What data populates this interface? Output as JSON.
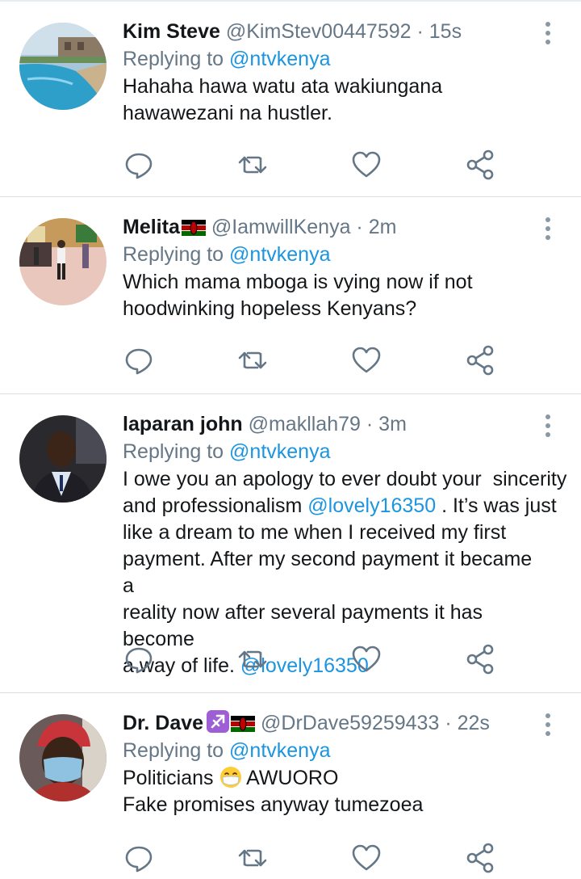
{
  "colors": {
    "accent": "#1b95e0",
    "muted": "#657786",
    "text": "#14171a",
    "divider": "#e6ecf0"
  },
  "icons": {
    "more": "more-vertical-icon",
    "reply": "reply-icon",
    "retweet": "retweet-icon",
    "like": "heart-icon",
    "share": "share-icon"
  },
  "tweets": [
    {
      "name": "Kim Steve",
      "handle": "@KimStev00447592",
      "separator": "·",
      "time": "15s",
      "replying_prefix": "Replying to",
      "replying_to": "@ntvkenya",
      "text_lines": [
        "Hahaha hawa watu ata wakiungana",
        "hawawezani na hustler."
      ]
    },
    {
      "name": "Melita",
      "handle": "@IamwillKenya",
      "separator": "·",
      "time": "2m",
      "replying_prefix": "Replying to",
      "replying_to": "@ntvkenya",
      "text_lines": [
        "Which mama mboga is vying now if not",
        "hoodwinking hopeless Kenyans?"
      ]
    },
    {
      "name": "laparan john",
      "handle": "@makllah79",
      "separator": "·",
      "time": "3m",
      "replying_prefix": "Replying to",
      "replying_to": "@ntvkenya",
      "text_line1": "I owe you an apology to ever doubt your  sincerity",
      "text_line2_pre": "and professionalism ",
      "mention_1": "@lovely16350",
      "text_line2_post": " . It’s was just",
      "text_line3": "like a dream to me when I received my first",
      "text_line4": "payment. After my second payment it became a",
      "text_line5": "reality now after several payments it has become",
      "text_line6_pre": "a way of life. ",
      "mention_2": "@lovely16350"
    },
    {
      "name": "Dr. Dave",
      "handle": "@DrDave59259433",
      "separator": "·",
      "time": "22s",
      "replying_prefix": "Replying to",
      "replying_to": "@ntvkenya",
      "text_line1_pre": "Politicians ",
      "text_line1_post": " AWUORO",
      "text_line2": "Fake promises anyway tumezoea"
    }
  ]
}
